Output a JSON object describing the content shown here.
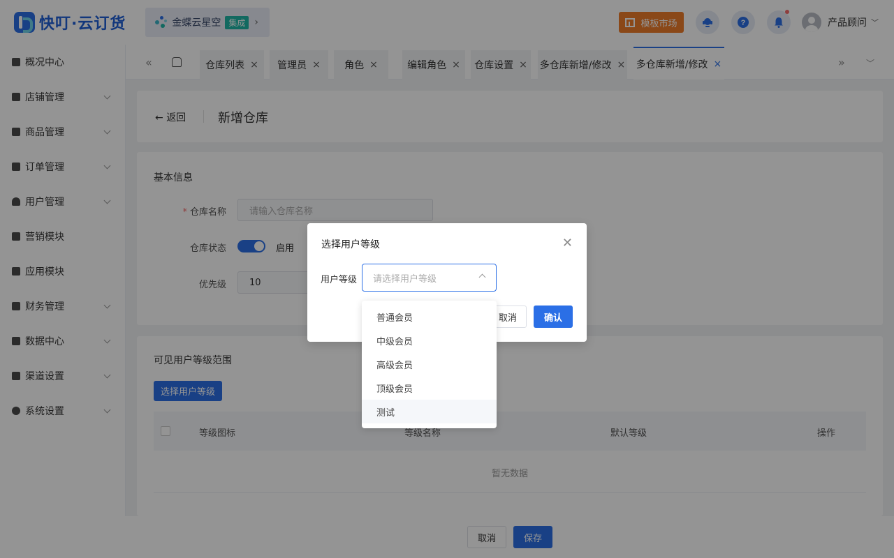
{
  "header": {
    "app_name": "快叮·云订货",
    "tenant_name": "金蝶云星空",
    "tenant_badge": "集成",
    "market_label": "模板市场",
    "user_name": "产品顾问",
    "icons": [
      "service-icon",
      "help-icon",
      "bell-icon",
      "user-avatar"
    ]
  },
  "sidebar": {
    "items": [
      {
        "label": "概况中心",
        "icon": "lock-icon",
        "expandable": false
      },
      {
        "label": "店铺管理",
        "icon": "store-icon",
        "expandable": true
      },
      {
        "label": "商品管理",
        "icon": "briefcase-icon",
        "expandable": true
      },
      {
        "label": "订单管理",
        "icon": "clipboard-icon",
        "expandable": true
      },
      {
        "label": "用户管理",
        "icon": "user-icon",
        "expandable": true
      },
      {
        "label": "营销模块",
        "icon": "chart-line-icon",
        "expandable": false
      },
      {
        "label": "应用模块",
        "icon": "grid-icon",
        "expandable": false
      },
      {
        "label": "财务管理",
        "icon": "wallet-icon",
        "expandable": true
      },
      {
        "label": "数据中心",
        "icon": "bar-chart-icon",
        "expandable": true
      },
      {
        "label": "渠道设置",
        "icon": "list-icon",
        "expandable": true
      },
      {
        "label": "系统设置",
        "icon": "gear-icon",
        "expandable": true
      }
    ]
  },
  "tabs": [
    {
      "label": "仓库列表"
    },
    {
      "label": "管理员"
    },
    {
      "label": "角色"
    },
    {
      "label": "编辑角色"
    },
    {
      "label": "仓库设置"
    },
    {
      "label": "多仓库新增/修改"
    },
    {
      "label": "多仓库新增/修改"
    }
  ],
  "page": {
    "back_label": "返回",
    "title": "新增仓库",
    "basic_section": "基本信息",
    "name_label": "仓库名称",
    "name_placeholder": "请输入仓库名称",
    "status_label": "仓库状态",
    "status_value": "启用",
    "priority_label": "优先级",
    "priority_value": "10",
    "scope_section": "可见用户等级范围",
    "choose_level_btn": "选择用户等级",
    "table_headers": [
      "等级图标",
      "等级名称",
      "默认等级",
      "操作"
    ],
    "empty_text": "暂无数据"
  },
  "footer": {
    "cancel_label": "取消",
    "save_label": "保存"
  },
  "dialog": {
    "title": "选择用户等级",
    "level_label": "用户等级",
    "select_placeholder": "请选择用户等级",
    "cancel_label": "取消",
    "confirm_label": "确认",
    "options": [
      "普通会员",
      "中级会员",
      "高级会员",
      "顶级会员",
      "测试"
    ]
  },
  "colors": {
    "primary": "#2b6fe6",
    "market_orange": "#ee7d2a",
    "tenant_badge": "#1fb6a6",
    "required": "#f56c6c"
  }
}
